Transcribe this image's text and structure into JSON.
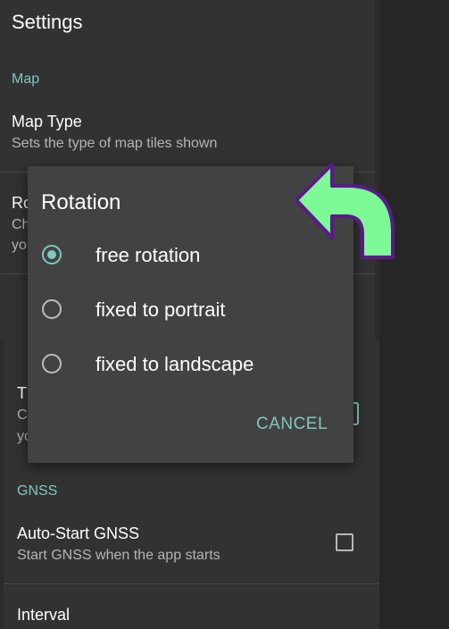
{
  "settings": {
    "title": "Settings",
    "sections": {
      "map": "Map",
      "gnss": "GNSS"
    },
    "map_type": {
      "title": "Map Type",
      "summary": "Sets the type of map tiles shown"
    },
    "rotation_partial": {
      "title": "Ro",
      "summary_line1": "Ch",
      "summary_line2": "yo"
    },
    "theme_partial": {
      "title": "T",
      "summary_line1": "C",
      "summary_line2": "yo"
    },
    "auto_start_gnss": {
      "title": "Auto-Start GNSS",
      "summary": "Start GNSS when the app starts"
    },
    "interval": {
      "title": "Interval"
    }
  },
  "dialog": {
    "title": "Rotation",
    "options": [
      {
        "label": "free rotation",
        "checked": true
      },
      {
        "label": "fixed to portrait",
        "checked": false
      },
      {
        "label": "fixed to landscape",
        "checked": false
      }
    ],
    "cancel_label": "CANCEL"
  },
  "colors": {
    "accent": "#7fc8bf",
    "arrow_fill": "#7dfa96",
    "arrow_stroke": "#5b1a8a"
  },
  "icons": {
    "arrow": "back-arrow-icon"
  }
}
